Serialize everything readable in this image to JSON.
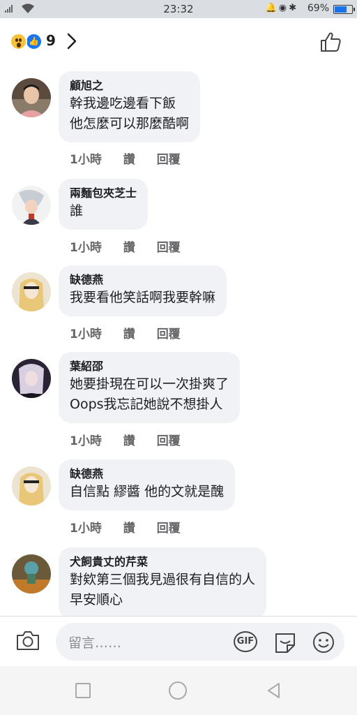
{
  "status_bar": {
    "time": "23:32",
    "system_icons": "🔔◉✱",
    "battery_percent": "69%",
    "battery_level": 0.69,
    "accent_color": "#1a73e8"
  },
  "reactions": {
    "count": "9",
    "icons": [
      "wow-emoji-icon",
      "like-emoji-icon"
    ]
  },
  "comments": [
    {
      "author": "顧旭之",
      "lines": [
        "幹我邊吃邊看下飯",
        "他怎麼可以那麼酷啊"
      ],
      "time": "1小時",
      "like": "讚",
      "reply": "回覆"
    },
    {
      "author": "兩麵包夾芝士",
      "lines": [
        "誰"
      ],
      "time": "1小時",
      "like": "讚",
      "reply": "回覆"
    },
    {
      "author": "缺德燕",
      "lines": [
        "我要看他笑話啊我要幹嘛"
      ],
      "time": "1小時",
      "like": "讚",
      "reply": "回覆"
    },
    {
      "author": "葉紹邵",
      "lines": [
        "她要掛現在可以一次掛爽了",
        "Oops我忘記她說不想掛人"
      ],
      "time": "1小時",
      "like": "讚",
      "reply": "回覆"
    },
    {
      "author": "缺德燕",
      "lines": [
        "自信點 繆醬 他的文就是醜"
      ],
      "time": "1小時",
      "like": "讚",
      "reply": "回覆"
    },
    {
      "author": "犬飼貴丈的芹菜",
      "lines": [
        "對欸第三個我見過很有自信的人",
        "早安順心"
      ]
    }
  ],
  "composer": {
    "placeholder": "留言……",
    "gif_label": "GIF"
  },
  "colors": {
    "bubble": "#f0f2f5",
    "like_blue": "#1877f2",
    "wow_yellow": "#f7c13a",
    "meta_gray": "#65676b"
  }
}
